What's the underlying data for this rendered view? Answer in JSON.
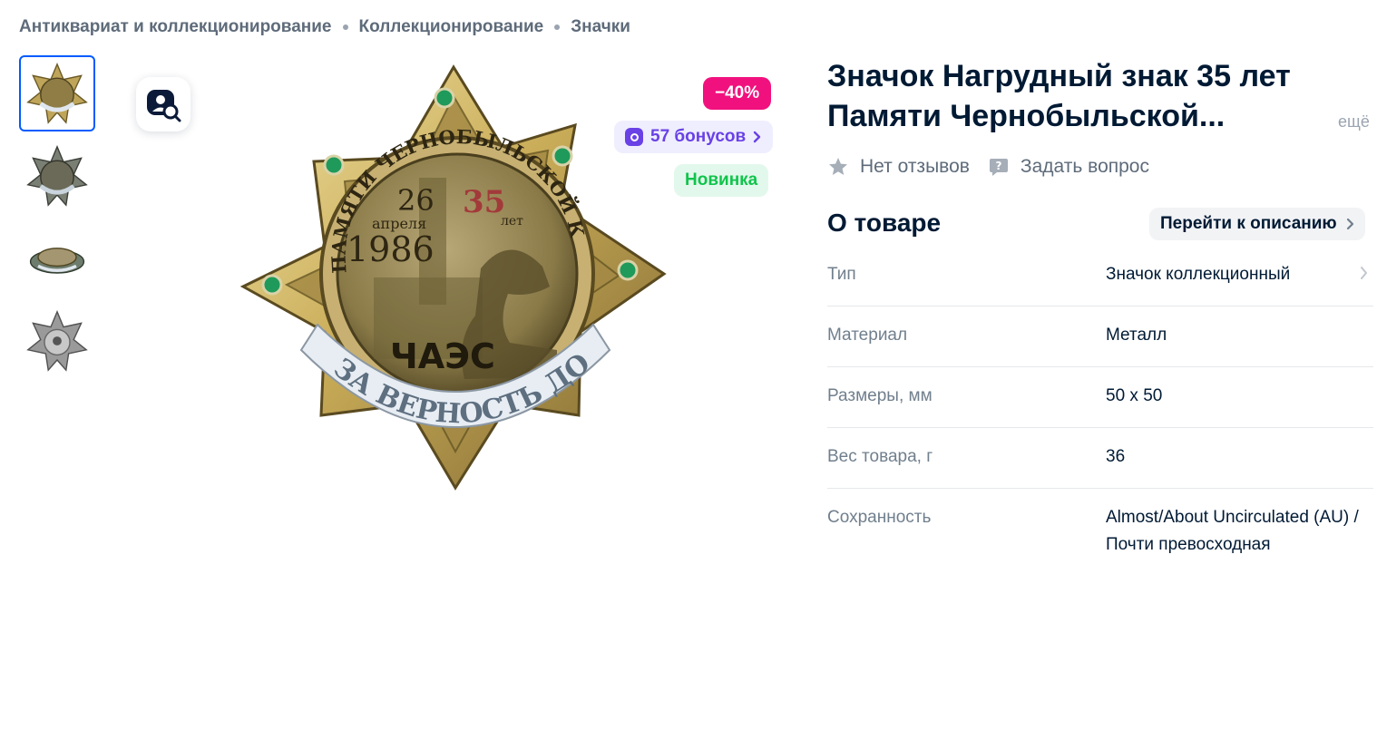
{
  "breadcrumbs": [
    "Антиквариат и коллекционирование",
    "Коллекционирование",
    "Значки"
  ],
  "badges": {
    "discount": "−40%",
    "bonus": "57 бонусов",
    "new": "Новинка"
  },
  "product": {
    "title": "Значок Нагрудный знак 35 лет Памяти Чернобыльской...",
    "more_link": "ещё",
    "reviews": "Нет отзывов",
    "ask_question": "Задать вопрос"
  },
  "about": {
    "title": "О товаре",
    "goto_description": "Перейти к описанию"
  },
  "specs": [
    {
      "label": "Тип",
      "value": "Значок коллекционный"
    },
    {
      "label": "Материал",
      "value": "Металл"
    },
    {
      "label": "Размеры, мм",
      "value": "50 x 50"
    },
    {
      "label": "Вес товара, г",
      "value": "36"
    },
    {
      "label": "Сохранность",
      "value": "Almost/About Uncirculated (AU) / Почти превосходная"
    }
  ],
  "badge_art": {
    "top_text": "ПАМЯТИ ЧЕРНОБЫЛЬСКОЙ КАТАСТРОФЫ",
    "date_day": "26",
    "date_month": "апреля",
    "year": "1986",
    "years": "35",
    "years_suffix": "лет",
    "station": "ЧАЭС",
    "ribbon": "ЗА ВЕРНОСТЬ ДОЛГУ"
  },
  "colors": {
    "accent": "#005bff",
    "discount": "#f1117e",
    "bonus": "#6941e6",
    "new": "#10c44c",
    "text_primary": "#001a34",
    "text_secondary": "#707f8d"
  }
}
